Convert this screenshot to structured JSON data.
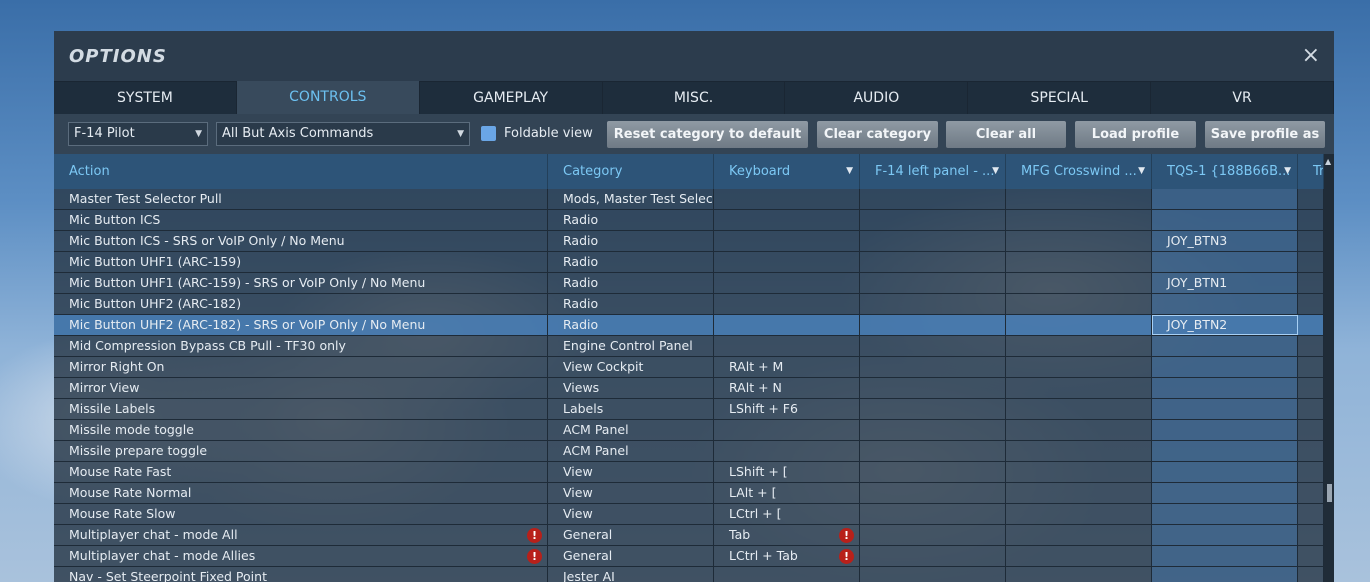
{
  "window": {
    "title": "OPTIONS",
    "close_icon": "×"
  },
  "tabs": [
    "SYSTEM",
    "CONTROLS",
    "GAMEPLAY",
    "MISC.",
    "AUDIO",
    "SPECIAL",
    "VR"
  ],
  "active_tab": "CONTROLS",
  "toolbar": {
    "aircraft_select": "F-14 Pilot",
    "filter_select": "All But Axis Commands",
    "foldable_view_label": "Foldable view",
    "foldable_view_checked": true,
    "reset_category_label": "Reset category to default",
    "clear_category_label": "Clear category",
    "clear_all_label": "Clear all",
    "load_profile_label": "Load profile",
    "save_profile_label": "Save profile as"
  },
  "columns": [
    "Action",
    "Category",
    "Keyboard",
    "F-14 left panel - ...",
    "MFG Crosswind ...",
    "TQS-1 {188B66B...",
    "Tr"
  ],
  "rows": [
    {
      "action": "Master Test Selector Pull",
      "category": "Mods, Master Test Selector",
      "keyboard": "",
      "left_panel": "",
      "crosswind": "",
      "tqs": "",
      "warn_action": false,
      "warn_keyboard": false,
      "selected": false
    },
    {
      "action": "Mic Button ICS",
      "category": "Radio",
      "keyboard": "",
      "left_panel": "",
      "crosswind": "",
      "tqs": "",
      "warn_action": false,
      "warn_keyboard": false,
      "selected": false
    },
    {
      "action": "Mic Button ICS - SRS or VoIP Only / No Menu",
      "category": "Radio",
      "keyboard": "",
      "left_panel": "",
      "crosswind": "",
      "tqs": "JOY_BTN3",
      "warn_action": false,
      "warn_keyboard": false,
      "selected": false
    },
    {
      "action": "Mic Button UHF1 (ARC-159)",
      "category": "Radio",
      "keyboard": "",
      "left_panel": "",
      "crosswind": "",
      "tqs": "",
      "warn_action": false,
      "warn_keyboard": false,
      "selected": false
    },
    {
      "action": "Mic Button UHF1 (ARC-159) - SRS or VoIP Only / No Menu",
      "category": "Radio",
      "keyboard": "",
      "left_panel": "",
      "crosswind": "",
      "tqs": "JOY_BTN1",
      "warn_action": false,
      "warn_keyboard": false,
      "selected": false
    },
    {
      "action": "Mic Button UHF2 (ARC-182)",
      "category": "Radio",
      "keyboard": "",
      "left_panel": "",
      "crosswind": "",
      "tqs": "",
      "warn_action": false,
      "warn_keyboard": false,
      "selected": false
    },
    {
      "action": "Mic Button UHF2 (ARC-182) - SRS or VoIP Only / No Menu",
      "category": "Radio",
      "keyboard": "",
      "left_panel": "",
      "crosswind": "",
      "tqs": "JOY_BTN2",
      "warn_action": false,
      "warn_keyboard": false,
      "selected": true
    },
    {
      "action": "Mid Compression Bypass CB Pull - TF30 only",
      "category": "Engine Control Panel",
      "keyboard": "",
      "left_panel": "",
      "crosswind": "",
      "tqs": "",
      "warn_action": false,
      "warn_keyboard": false,
      "selected": false
    },
    {
      "action": "Mirror Right On",
      "category": "View Cockpit",
      "keyboard": "RAlt + M",
      "left_panel": "",
      "crosswind": "",
      "tqs": "",
      "warn_action": false,
      "warn_keyboard": false,
      "selected": false
    },
    {
      "action": "Mirror View",
      "category": "Views",
      "keyboard": "RAlt + N",
      "left_panel": "",
      "crosswind": "",
      "tqs": "",
      "warn_action": false,
      "warn_keyboard": false,
      "selected": false
    },
    {
      "action": "Missile Labels",
      "category": "Labels",
      "keyboard": "LShift + F6",
      "left_panel": "",
      "crosswind": "",
      "tqs": "",
      "warn_action": false,
      "warn_keyboard": false,
      "selected": false
    },
    {
      "action": "Missile mode toggle",
      "category": "ACM Panel",
      "keyboard": "",
      "left_panel": "",
      "crosswind": "",
      "tqs": "",
      "warn_action": false,
      "warn_keyboard": false,
      "selected": false
    },
    {
      "action": "Missile prepare toggle",
      "category": "ACM Panel",
      "keyboard": "",
      "left_panel": "",
      "crosswind": "",
      "tqs": "",
      "warn_action": false,
      "warn_keyboard": false,
      "selected": false
    },
    {
      "action": "Mouse Rate Fast",
      "category": "View",
      "keyboard": "LShift + [",
      "left_panel": "",
      "crosswind": "",
      "tqs": "",
      "warn_action": false,
      "warn_keyboard": false,
      "selected": false
    },
    {
      "action": "Mouse Rate Normal",
      "category": "View",
      "keyboard": "LAlt + [",
      "left_panel": "",
      "crosswind": "",
      "tqs": "",
      "warn_action": false,
      "warn_keyboard": false,
      "selected": false
    },
    {
      "action": "Mouse Rate Slow",
      "category": "View",
      "keyboard": "LCtrl + [",
      "left_panel": "",
      "crosswind": "",
      "tqs": "",
      "warn_action": false,
      "warn_keyboard": false,
      "selected": false
    },
    {
      "action": "Multiplayer chat - mode All",
      "category": "General",
      "keyboard": "Tab",
      "left_panel": "",
      "crosswind": "",
      "tqs": "",
      "warn_action": true,
      "warn_keyboard": true,
      "selected": false
    },
    {
      "action": "Multiplayer chat - mode Allies",
      "category": "General",
      "keyboard": "LCtrl + Tab",
      "left_panel": "",
      "crosswind": "",
      "tqs": "",
      "warn_action": true,
      "warn_keyboard": true,
      "selected": false
    },
    {
      "action": "Nav - Set Steerpoint Fixed Point",
      "category": "Jester AI",
      "keyboard": "",
      "left_panel": "",
      "crosswind": "",
      "tqs": "",
      "warn_action": false,
      "warn_keyboard": false,
      "selected": false
    }
  ],
  "warning_icon": "!",
  "colors": {
    "accent": "#6cc0f0",
    "selected_row": "#4a84c0",
    "warning": "#b8201a"
  }
}
